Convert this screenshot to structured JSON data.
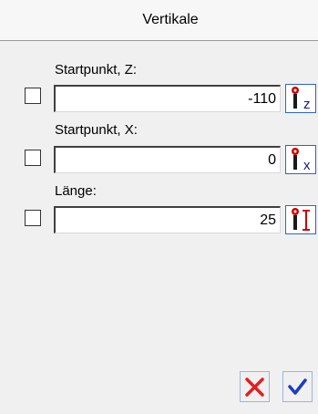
{
  "window": {
    "title": "Vertikale"
  },
  "fields": [
    {
      "label": "Startpunkt, Z:",
      "value": "-110",
      "icon": "pick-z-icon",
      "checked": false
    },
    {
      "label": "Startpunkt, X:",
      "value": "0",
      "icon": "pick-x-icon",
      "checked": false
    },
    {
      "label": "Länge:",
      "value": "25",
      "icon": "pick-length-icon",
      "checked": false
    }
  ],
  "buttons": {
    "cancel_icon": "red-x-icon",
    "ok_icon": "blue-checkmark-icon"
  },
  "colors": {
    "pick_border": "#2a67c8",
    "pick_red": "#cc0000",
    "cancel_red": "#e02020",
    "ok_blue": "#1f3bbf"
  }
}
